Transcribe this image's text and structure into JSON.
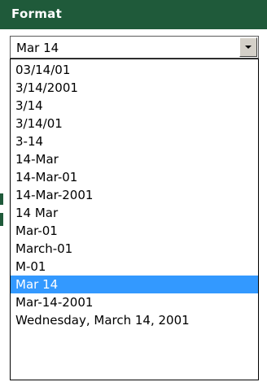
{
  "header": {
    "title": "Format"
  },
  "combo": {
    "value": "Mar 14",
    "arrow_icon": "chevron-down-icon"
  },
  "dropdown": {
    "items": [
      "03/14/01",
      "3/14/2001",
      "3/14",
      "3/14/01",
      "3-14",
      "14-Mar",
      "14-Mar-01",
      "14-Mar-2001",
      "14 Mar",
      "Mar-01",
      "March-01",
      "M-01",
      "Mar 14",
      "Mar-14-2001",
      "Wednesday, March 14, 2001"
    ],
    "selected_index": 12
  },
  "colors": {
    "header_bg": "#1f5a3a",
    "selection_bg": "#3399ff",
    "selection_text": "#ffffff"
  }
}
